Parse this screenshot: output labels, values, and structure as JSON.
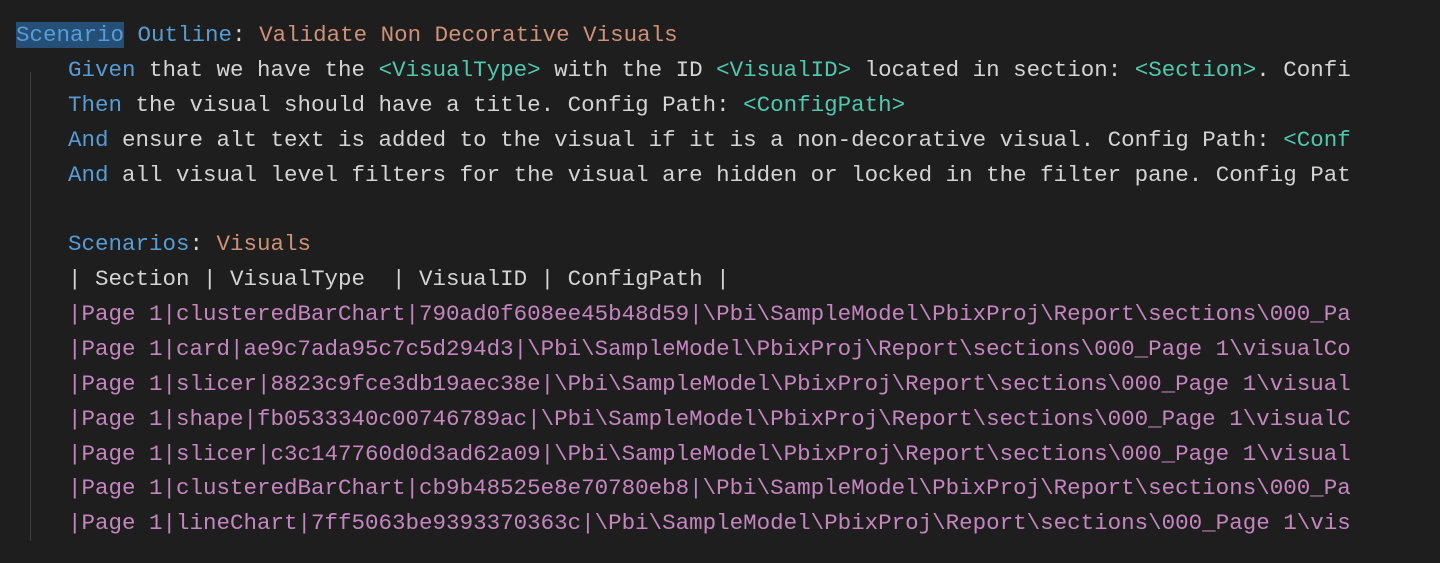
{
  "scenarioOutline": {
    "keyword": "Scenario Outline",
    "colon": ":",
    "title": " Validate Non Decorative Visuals"
  },
  "steps": {
    "given": {
      "keyword": "Given",
      "text1": " that we have the ",
      "ph1": "<VisualType>",
      "text2": " with the ID ",
      "ph2": "<VisualID>",
      "text3": " located in section: ",
      "ph3": "<Section>",
      "text4": ". Confi"
    },
    "then": {
      "keyword": "Then",
      "text1": " the visual should have a title. Config Path: ",
      "ph1": "<ConfigPath>"
    },
    "and1": {
      "keyword": "And",
      "text1": " ensure alt text is added to the visual if it is a non-decorative visual. Config Path: ",
      "ph1": "<Conf"
    },
    "and2": {
      "keyword": "And",
      "text1": " all visual level filters for the visual are hidden or locked in the filter pane. Config Pat"
    }
  },
  "scenarios": {
    "keyword": "Scenarios",
    "colon": ":",
    "name": " Visuals"
  },
  "tableHeader": "| Section | VisualType  | VisualID | ConfigPath |",
  "tableRows": [
    "|Page 1|clusteredBarChart|790ad0f608ee45b48d59|\\Pbi\\SampleModel\\PbixProj\\Report\\sections\\000_Pa",
    "|Page 1|card|ae9c7ada95c7c5d294d3|\\Pbi\\SampleModel\\PbixProj\\Report\\sections\\000_Page 1\\visualCo",
    "|Page 1|slicer|8823c9fce3db19aec38e|\\Pbi\\SampleModel\\PbixProj\\Report\\sections\\000_Page 1\\visual",
    "|Page 1|shape|fb0533340c00746789ac|\\Pbi\\SampleModel\\PbixProj\\Report\\sections\\000_Page 1\\visualC",
    "|Page 1|slicer|c3c147760d0d3ad62a09|\\Pbi\\SampleModel\\PbixProj\\Report\\sections\\000_Page 1\\visual",
    "|Page 1|clusteredBarChart|cb9b48525e8e70780eb8|\\Pbi\\SampleModel\\PbixProj\\Report\\sections\\000_Pa",
    "|Page 1|lineChart|7ff5063be9393370363c|\\Pbi\\SampleModel\\PbixProj\\Report\\sections\\000_Page 1\\vis"
  ]
}
